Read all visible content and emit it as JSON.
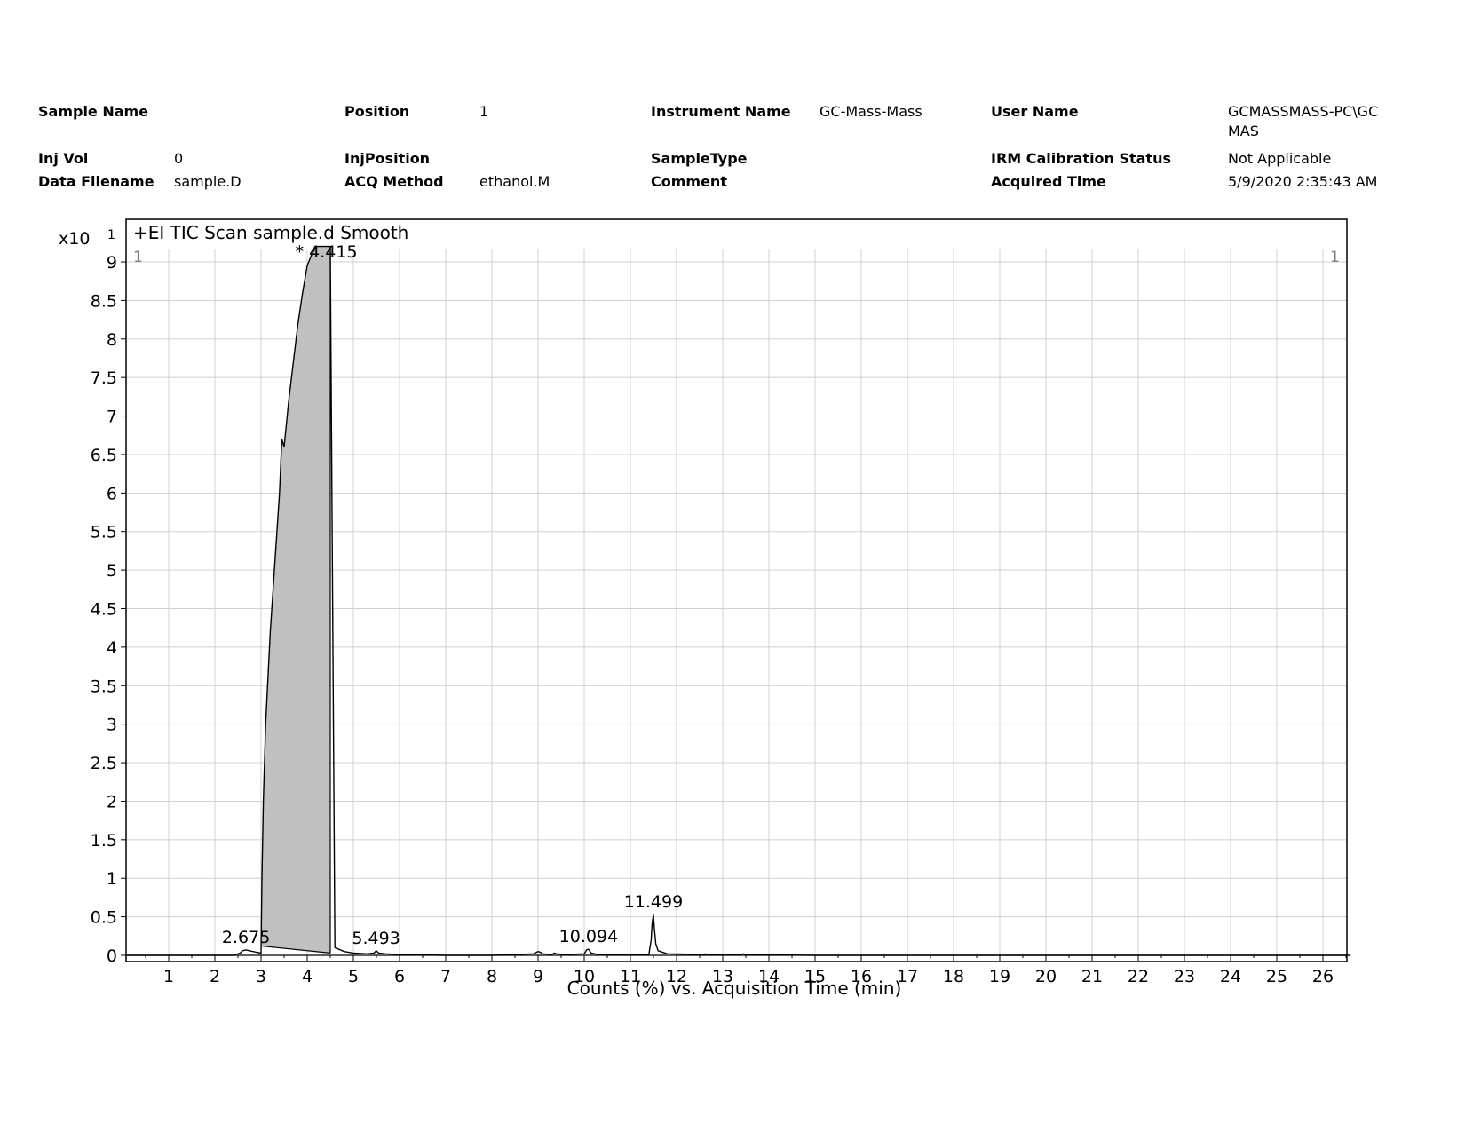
{
  "header": {
    "sample_name": {
      "label": "Sample Name",
      "value": ""
    },
    "position": {
      "label": "Position",
      "value": "1"
    },
    "instrument_name": {
      "label": "Instrument Name",
      "value": "GC-Mass-Mass"
    },
    "user_name": {
      "label": "User Name",
      "value": "GCMASSMASS-PC\\GC\nMAS"
    },
    "inj_vol": {
      "label": "Inj Vol",
      "value": "0"
    },
    "inj_position": {
      "label": "InjPosition",
      "value": ""
    },
    "sample_type": {
      "label": "SampleType",
      "value": ""
    },
    "irm_status": {
      "label": "IRM Calibration Status",
      "value": "Not Applicable"
    },
    "data_filename": {
      "label": "Data Filename",
      "value": "sample.D"
    },
    "acq_method": {
      "label": "ACQ Method",
      "value": "ethanol.M"
    },
    "comment": {
      "label": "Comment",
      "value": ""
    },
    "acquired_time": {
      "label": "Acquired Time",
      "value": "5/9/2020 2:35:43 AM"
    }
  },
  "chart_data": {
    "type": "line",
    "title": "+EI TIC Scan sample.d  Smooth",
    "xlabel": "Counts (%) vs. Acquisition Time (min)",
    "ylabel": "",
    "y_multiplier": "x10",
    "y_exponent": "1",
    "corner_left": "1",
    "corner_right": "1",
    "xlim": [
      0.1,
      26.6
    ],
    "ylim": [
      0,
      9.2
    ],
    "x_ticks": [
      1,
      2,
      3,
      4,
      5,
      6,
      7,
      8,
      9,
      10,
      11,
      12,
      13,
      14,
      15,
      16,
      17,
      18,
      19,
      20,
      21,
      22,
      23,
      24,
      25,
      26
    ],
    "y_ticks": [
      0,
      0.5,
      1,
      1.5,
      2,
      2.5,
      3,
      3.5,
      4,
      4.5,
      5,
      5.5,
      6,
      6.5,
      7,
      7.5,
      8,
      8.5,
      9
    ],
    "grid": true,
    "line_color": "#000000",
    "fill_color": "#c0c0c0",
    "series": [
      {
        "x": [
          0.1,
          2.4,
          2.55,
          2.6,
          2.675,
          2.75,
          2.9,
          3.0,
          3.02,
          3.05,
          3.1,
          3.2,
          3.3,
          3.4,
          3.45,
          3.5,
          3.6,
          3.7,
          3.8,
          3.9,
          4.0,
          4.1,
          4.2,
          4.3,
          4.35,
          4.4,
          4.415,
          4.45,
          4.5,
          4.6,
          4.8,
          5.0,
          5.3,
          5.45,
          5.493,
          5.55,
          5.7,
          6.0,
          7.0,
          8.0,
          8.9,
          9.0,
          9.05,
          9.1,
          9.3,
          9.35,
          9.4,
          9.6,
          10.0,
          10.05,
          10.094,
          10.15,
          10.3,
          11.0,
          11.4,
          11.45,
          11.47,
          11.499,
          11.52,
          11.55,
          11.6,
          11.8,
          12.6,
          12.62,
          12.65,
          13.4,
          13.45,
          13.5,
          15.0,
          20.0,
          26.6
        ],
        "y": [
          0,
          0,
          0.03,
          0.06,
          0.07,
          0.06,
          0.04,
          0.03,
          1.0,
          2.0,
          3.0,
          4.2,
          5.1,
          6.0,
          6.7,
          6.6,
          7.2,
          7.7,
          8.2,
          8.6,
          8.95,
          9.1,
          9.2,
          9.2,
          9.2,
          9.2,
          9.2,
          9.2,
          9.2,
          0.1,
          0.05,
          0.03,
          0.02,
          0.03,
          0.06,
          0.03,
          0.02,
          0.01,
          0,
          0,
          0.02,
          0.05,
          0.04,
          0.02,
          0.01,
          0.03,
          0.02,
          0.01,
          0.02,
          0.07,
          0.08,
          0.03,
          0.01,
          0.01,
          0.01,
          0.2,
          0.4,
          0.53,
          0.35,
          0.15,
          0.06,
          0.02,
          0.01,
          0.02,
          0.01,
          0.01,
          0.02,
          0.01,
          0,
          0,
          0
        ]
      }
    ],
    "shaded_peak": {
      "x_start": 3.02,
      "x_end": 4.5,
      "base_start": 0.12,
      "base_end": 0.03
    },
    "peak_labels": [
      {
        "x": 2.675,
        "y": 0.07,
        "text": "2.675"
      },
      {
        "x": 4.415,
        "y": 9.2,
        "text": "* 4.415"
      },
      {
        "x": 5.493,
        "y": 0.06,
        "text": "5.493"
      },
      {
        "x": 10.094,
        "y": 0.08,
        "text": "10.094"
      },
      {
        "x": 11.499,
        "y": 0.53,
        "text": "11.499"
      }
    ]
  }
}
